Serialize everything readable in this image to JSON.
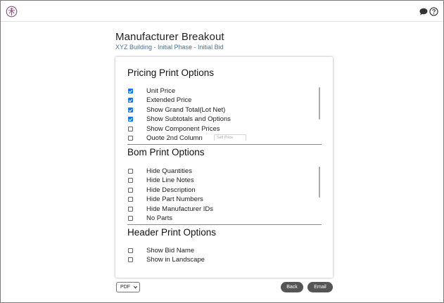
{
  "header": {
    "title": "Manufacturer Breakout",
    "subtitle": "XYZ Building - Initial Phase - Initial Bid"
  },
  "icons": {
    "logo": "app-logo",
    "chat": "chat-bubble-icon",
    "help": "help-circle-icon"
  },
  "pricing": {
    "title": "Pricing Print Options",
    "options": [
      {
        "label": "Unit Price",
        "checked": true
      },
      {
        "label": "Extended Price",
        "checked": true
      },
      {
        "label": "Show Grand Total(Lot Net)",
        "checked": true
      },
      {
        "label": "Show Subtotals and Options",
        "checked": true
      },
      {
        "label": "Show Component Prices",
        "checked": false
      },
      {
        "label": "Quote 2nd Column",
        "checked": false
      }
    ],
    "column_select": "Sell Price"
  },
  "bom": {
    "title": "Bom Print Options",
    "options": [
      {
        "label": "Hide Quantities",
        "checked": false
      },
      {
        "label": "Hide Line Notes",
        "checked": false
      },
      {
        "label": "Hide Description",
        "checked": false
      },
      {
        "label": "Hide Part Numbers",
        "checked": false
      },
      {
        "label": "Hide Manufacturer IDs",
        "checked": false
      },
      {
        "label": "No Parts",
        "checked": false
      }
    ]
  },
  "header_options": {
    "title": "Header Print Options",
    "options": [
      {
        "label": "Show Bid Name",
        "checked": false
      },
      {
        "label": "Show in Landscape",
        "checked": false
      }
    ]
  },
  "footer": {
    "format_select": "PDF",
    "back_label": "Back",
    "email_label": "Email"
  },
  "colors": {
    "accent": "#1a73e8",
    "subtitle": "#4a7296",
    "button": "#555555"
  }
}
